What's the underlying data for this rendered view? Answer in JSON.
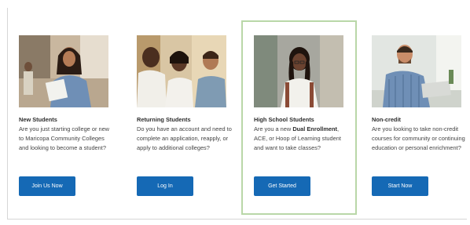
{
  "cards": [
    {
      "title": "New Students",
      "description": "Are you just starting college or new to Maricopa Community Colleges and looking to become a student?",
      "button_label": "Join Us Now"
    },
    {
      "title": "Returning Students",
      "description": "Do you have an account and need to complete an application, reapply, or apply to additional colleges?",
      "button_label": "Log In"
    },
    {
      "title": "High School Students",
      "description_prefix": "Are you a new ",
      "description_bold": "Dual Enrollment",
      "description_suffix": ", ACE, or Hoop of Learning student and want to take classes?",
      "button_label": "Get Started"
    },
    {
      "title": "Non-credit",
      "description": "Are you looking to take non-credit courses for community or continuing education or personal enrichment?",
      "button_label": "Start Now"
    }
  ],
  "colors": {
    "button": "#1569b5",
    "highlight_border": "#b9d7a8"
  }
}
